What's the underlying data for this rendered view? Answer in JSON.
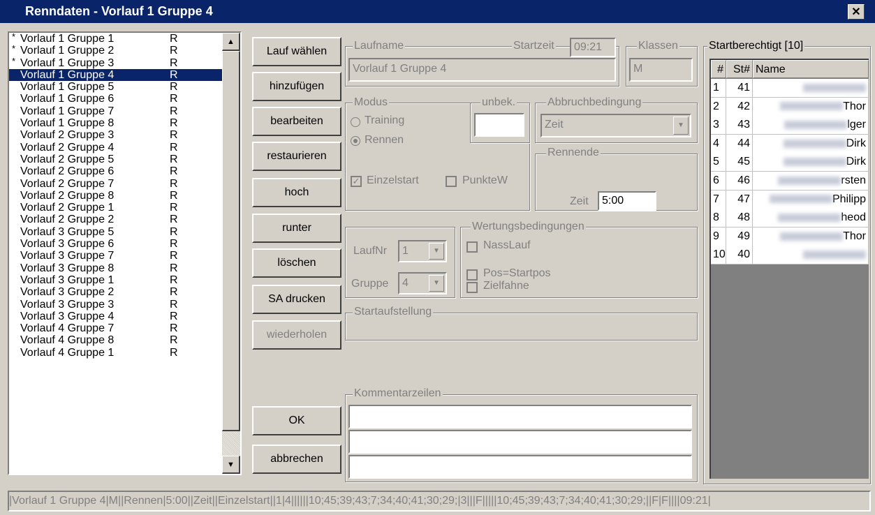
{
  "window": {
    "title": "Renndaten - Vorlauf 1 Gruppe 4",
    "close_label": "✕"
  },
  "runs": [
    {
      "mark": "*",
      "name": "Vorlauf 1 Gruppe 1",
      "flag": "R"
    },
    {
      "mark": "*",
      "name": "Vorlauf 1 Gruppe 2",
      "flag": "R"
    },
    {
      "mark": "*",
      "name": "Vorlauf 1 Gruppe 3",
      "flag": "R"
    },
    {
      "mark": "",
      "name": "Vorlauf 1 Gruppe 4",
      "flag": "R"
    },
    {
      "mark": "",
      "name": "Vorlauf 1 Gruppe 5",
      "flag": "R"
    },
    {
      "mark": "",
      "name": "Vorlauf 1 Gruppe 6",
      "flag": "R"
    },
    {
      "mark": "",
      "name": "Vorlauf 1 Gruppe 7",
      "flag": "R"
    },
    {
      "mark": "",
      "name": "Vorlauf 1 Gruppe 8",
      "flag": "R"
    },
    {
      "mark": "",
      "name": "Vorlauf 2 Gruppe 3",
      "flag": "R"
    },
    {
      "mark": "",
      "name": "Vorlauf 2 Gruppe 4",
      "flag": "R"
    },
    {
      "mark": "",
      "name": "Vorlauf 2 Gruppe 5",
      "flag": "R"
    },
    {
      "mark": "",
      "name": "Vorlauf 2 Gruppe 6",
      "flag": "R"
    },
    {
      "mark": "",
      "name": "Vorlauf 2 Gruppe 7",
      "flag": "R"
    },
    {
      "mark": "",
      "name": "Vorlauf 2 Gruppe 8",
      "flag": "R"
    },
    {
      "mark": "",
      "name": "Vorlauf 2 Gruppe 1",
      "flag": "R"
    },
    {
      "mark": "",
      "name": "Vorlauf 2 Gruppe 2",
      "flag": "R"
    },
    {
      "mark": "",
      "name": "Vorlauf 3 Gruppe 5",
      "flag": "R"
    },
    {
      "mark": "",
      "name": "Vorlauf 3 Gruppe 6",
      "flag": "R"
    },
    {
      "mark": "",
      "name": "Vorlauf 3 Gruppe 7",
      "flag": "R"
    },
    {
      "mark": "",
      "name": "Vorlauf 3 Gruppe 8",
      "flag": "R"
    },
    {
      "mark": "",
      "name": "Vorlauf 3 Gruppe 1",
      "flag": "R"
    },
    {
      "mark": "",
      "name": "Vorlauf 3 Gruppe 2",
      "flag": "R"
    },
    {
      "mark": "",
      "name": "Vorlauf 3 Gruppe 3",
      "flag": "R"
    },
    {
      "mark": "",
      "name": "Vorlauf 3 Gruppe 4",
      "flag": "R"
    },
    {
      "mark": "",
      "name": "Vorlauf 4 Gruppe 7",
      "flag": "R"
    },
    {
      "mark": "",
      "name": "Vorlauf 4 Gruppe 8",
      "flag": "R"
    },
    {
      "mark": "",
      "name": "Vorlauf 4 Gruppe 1",
      "flag": "R"
    }
  ],
  "selected_run_index": 3,
  "buttons": {
    "lauf_waehlen": "Lauf wählen",
    "hinzufuegen": "hinzufügen",
    "bearbeiten": "bearbeiten",
    "restaurieren": "restaurieren",
    "hoch": "hoch",
    "runter": "runter",
    "loeschen": "löschen",
    "sa_drucken": "SA drucken",
    "wiederholen": "wiederholen",
    "ok": "OK",
    "abbrechen": "abbrechen"
  },
  "laufname": {
    "label": "Laufname",
    "value": "Vorlauf 1 Gruppe 4",
    "startzeit_label": "Startzeit",
    "startzeit": "09:21"
  },
  "klassen": {
    "label": "Klassen",
    "value": "M"
  },
  "modus": {
    "label": "Modus",
    "training": "Training",
    "rennen": "Rennen",
    "selected": "rennen"
  },
  "unbek": {
    "label": "unbek.",
    "value": ""
  },
  "abbruch": {
    "label": "Abbruchbedingung",
    "value": "Zeit"
  },
  "einzelstart": {
    "label": "Einzelstart",
    "checked": true
  },
  "punktew": {
    "label": "PunkteW",
    "checked": false
  },
  "rennende": {
    "label": "Rennende",
    "zeit_label": "Zeit",
    "zeit": "5:00"
  },
  "laufnr": {
    "label": "LaufNr",
    "value": "1"
  },
  "gruppe": {
    "label": "Gruppe",
    "value": "4"
  },
  "wertung": {
    "label": "Wertungsbedingungen",
    "nasslauf": "NassLauf",
    "pos": "Pos=Startpos",
    "zielfahne": "Zielfahne"
  },
  "startaufstellung": {
    "label": "Startaufstellung"
  },
  "kommentar": {
    "label": "Kommentarzeilen",
    "lines": [
      "",
      "",
      ""
    ]
  },
  "startberechtigt": {
    "label": "Startberechtigt [10]",
    "headers": [
      "#",
      "St#",
      "Name"
    ],
    "rows": [
      {
        "nr": "1",
        "st": "41",
        "name": ""
      },
      {
        "nr": "2",
        "st": "42",
        "name": "Thor"
      },
      {
        "nr": "3",
        "st": "43",
        "name": "lger"
      },
      {
        "nr": "4",
        "st": "44",
        "name": "Dirk"
      },
      {
        "nr": "5",
        "st": "45",
        "name": "Dirk"
      },
      {
        "nr": "6",
        "st": "46",
        "name": "rsten"
      },
      {
        "nr": "7",
        "st": "47",
        "name": "Philipp"
      },
      {
        "nr": "8",
        "st": "48",
        "name": "heod"
      },
      {
        "nr": "9",
        "st": "49",
        "name": "Thor"
      },
      {
        "nr": "10",
        "st": "40",
        "name": ""
      }
    ]
  },
  "statusbar": "|Vorlauf 1 Gruppe 4|M||Rennen|5:00||Zeit||Einzelstart||1|4||||||10;45;39;43;7;34;40;41;30;29;|3|||F|||||10;45;39;43;7;34;40;41;30;29;||F|F||||09:21|"
}
